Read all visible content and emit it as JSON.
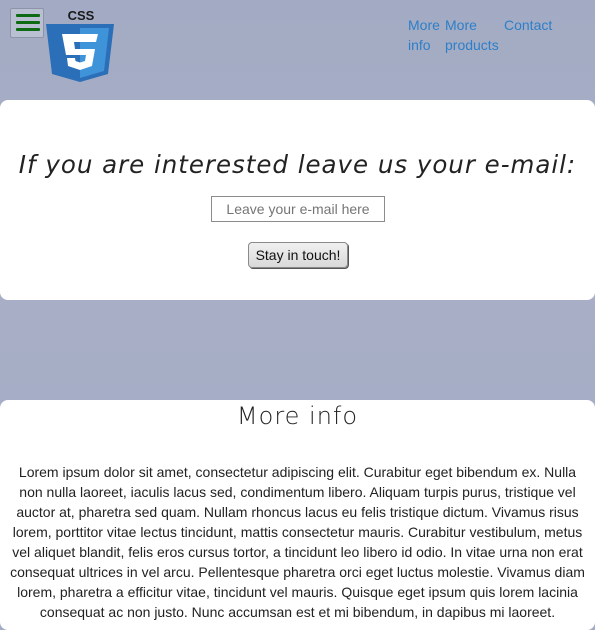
{
  "header": {
    "menu_icon": "hamburger-icon",
    "logo_icon": "css3-logo",
    "logo_text": "CSS",
    "nav": [
      {
        "label": "More info"
      },
      {
        "label": "More products"
      },
      {
        "label": "Contact"
      }
    ]
  },
  "signup": {
    "heading": "If you are interested leave us your e-mail:",
    "email_placeholder": "Leave your e-mail here",
    "button_label": "Stay in touch!"
  },
  "info": {
    "heading": "More info",
    "body": "Lorem ipsum dolor sit amet, consectetur adipiscing elit. Curabitur eget bibendum ex. Nulla non nulla laoreet, iaculis lacus sed, condimentum libero. Aliquam turpis purus, tristique vel auctor at, pharetra sed quam. Nullam rhoncus lacus eu felis tristique dictum. Vivamus risus lorem, porttitor vitae lectus tincidunt, mattis consectetur mauris. Curabitur vestibulum, metus vel aliquet blandit, felis eros cursus tortor, a tincidunt leo libero id odio. In vitae urna non erat consequat ultrices in vel arcu. Pellentesque pharetra orci eget luctus molestie. Vivamus diam lorem, pharetra a efficitur vitae, tincidunt vel mauris. Quisque eget ipsum quis lorem lacinia consequat ac non justo. Nunc accumsan est et mi bibendum, in dapibus mi laoreet."
  },
  "colors": {
    "link": "#2d7fc8",
    "menu_bars": "#0f6a14",
    "logo_blue": "#2a6fb8",
    "logo_light": "#3f94d9"
  }
}
